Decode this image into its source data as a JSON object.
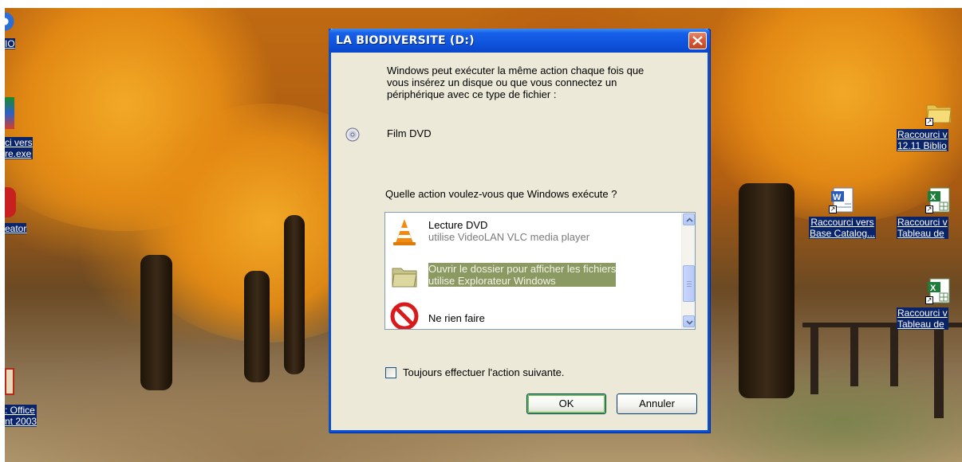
{
  "desktop": {
    "left_icons": [
      {
        "name": "ie-shortcut",
        "lines": [
          "IO"
        ]
      },
      {
        "name": "shortcut-exe",
        "lines": [
          "ci vers",
          "re.exe"
        ]
      },
      {
        "name": "creator-shortcut",
        "lines": [
          "eator"
        ]
      },
      {
        "name": "office-shortcut",
        "lines": [
          ": Office",
          "nt 2003"
        ]
      }
    ],
    "right_icons": [
      {
        "name": "folder-shortcut",
        "lines": [
          "Raccourci v",
          "12.11 Biblio"
        ]
      },
      {
        "name": "word-shortcut",
        "lines": [
          "Raccourci vers",
          "Base Catalog..."
        ]
      },
      {
        "name": "excel-shortcut-1",
        "lines": [
          "Raccourci v",
          "Tableau de"
        ]
      },
      {
        "name": "excel-shortcut-2",
        "lines": [
          "Raccourci v",
          "Tableau de"
        ]
      }
    ]
  },
  "dialog": {
    "title": "LA BIODIVERSITE (D:)",
    "intro_lines": [
      "Windows peut exécuter la même action chaque fois que",
      "vous insérez un disque ou que vous connectez un",
      "périphérique avec ce type de fichier :"
    ],
    "media_type": "Film DVD",
    "question": "Quelle action voulez-vous que Windows exécute ?",
    "actions": [
      {
        "main": "Lecture DVD",
        "sub": "utilise VideoLAN VLC media player",
        "icon": "vlc-cone-icon",
        "selected": false
      },
      {
        "main": "Ouvrir le dossier pour afficher les fichiers",
        "sub": "utilise Explorateur Windows",
        "icon": "folder-icon",
        "selected": true
      },
      {
        "main": "Ne rien faire",
        "sub": "",
        "icon": "no-entry-icon",
        "selected": false
      }
    ],
    "always_label": "Toujours effectuer l'action suivante.",
    "always_checked": false,
    "ok_label": "OK",
    "cancel_label": "Annuler"
  },
  "colors": {
    "titlebar": "#0f54de",
    "selection": "#8b9a63",
    "close_button": "#d65a36"
  }
}
